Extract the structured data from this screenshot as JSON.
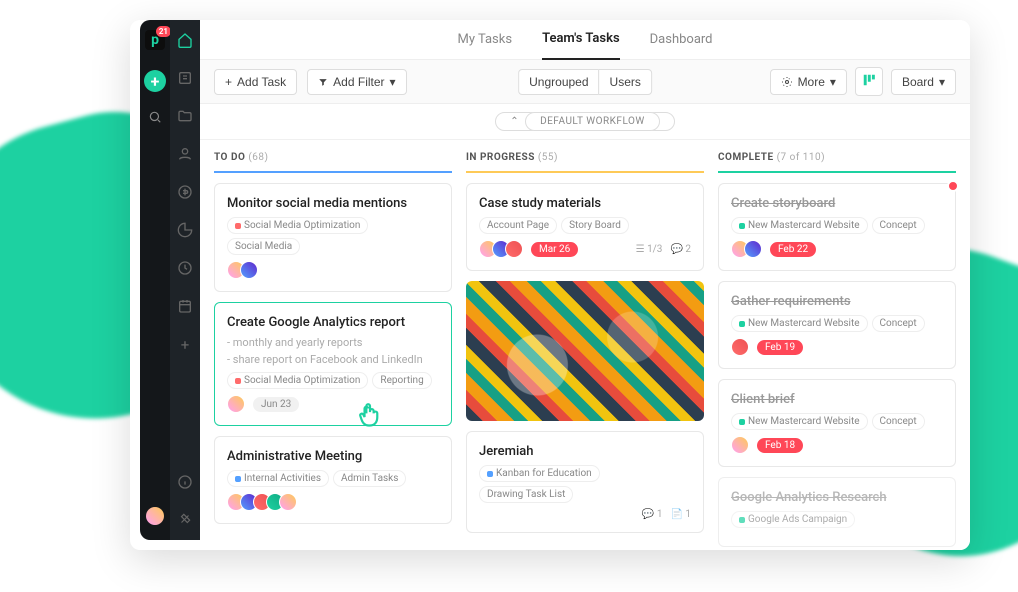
{
  "logo_badge": "21",
  "tabs": {
    "my_tasks": "My Tasks",
    "teams_tasks": "Team's Tasks",
    "dashboard": "Dashboard"
  },
  "toolbar": {
    "add_task": "Add Task",
    "add_filter": "Add Filter",
    "ungrouped": "Ungrouped",
    "users": "Users",
    "more": "More",
    "board": "Board"
  },
  "workflow": "DEFAULT WORKFLOW",
  "columns": {
    "todo": {
      "label": "TO DO",
      "count": "(68)"
    },
    "progress": {
      "label": "IN PROGRESS",
      "count": "(55)"
    },
    "complete": {
      "label": "COMPLETE",
      "count": "(7 of 110)"
    }
  },
  "cards": {
    "c1": {
      "title": "Monitor social media mentions",
      "tag1": "Social Media Optimization",
      "tag2": "Social Media"
    },
    "c2": {
      "title": "Create Google Analytics report",
      "sub1": "- monthly and yearly reports",
      "sub2": "- share report on Facebook and LinkedIn",
      "tag1": "Social Media Optimization",
      "tag2": "Reporting",
      "date": "Jun 23"
    },
    "c3": {
      "title": "Administrative Meeting",
      "tag1": "Internal Activities",
      "tag2": "Admin Tasks"
    },
    "c4": {
      "title": "Case study materials",
      "tag1": "Account Page",
      "tag2": "Story Board",
      "date": "Mar 26",
      "list": "1/3",
      "comments": "2"
    },
    "c5": {
      "title": "Jeremiah",
      "tag1": "Kanban for Education",
      "tag2": "Drawing Task List",
      "comments": "1",
      "files": "1"
    },
    "c6": {
      "title": "Create storyboard",
      "tag1": "New Mastercard Website",
      "tag2": "Concept",
      "date": "Feb 22"
    },
    "c7": {
      "title": "Gather requirements",
      "tag1": "New Mastercard Website",
      "tag2": "Concept",
      "date": "Feb 19"
    },
    "c8": {
      "title": "Client brief",
      "tag1": "New Mastercard Website",
      "tag2": "Concept",
      "date": "Feb 18"
    },
    "c9": {
      "title": "Google Analytics Research",
      "tag1": "Google Ads Campaign"
    }
  }
}
